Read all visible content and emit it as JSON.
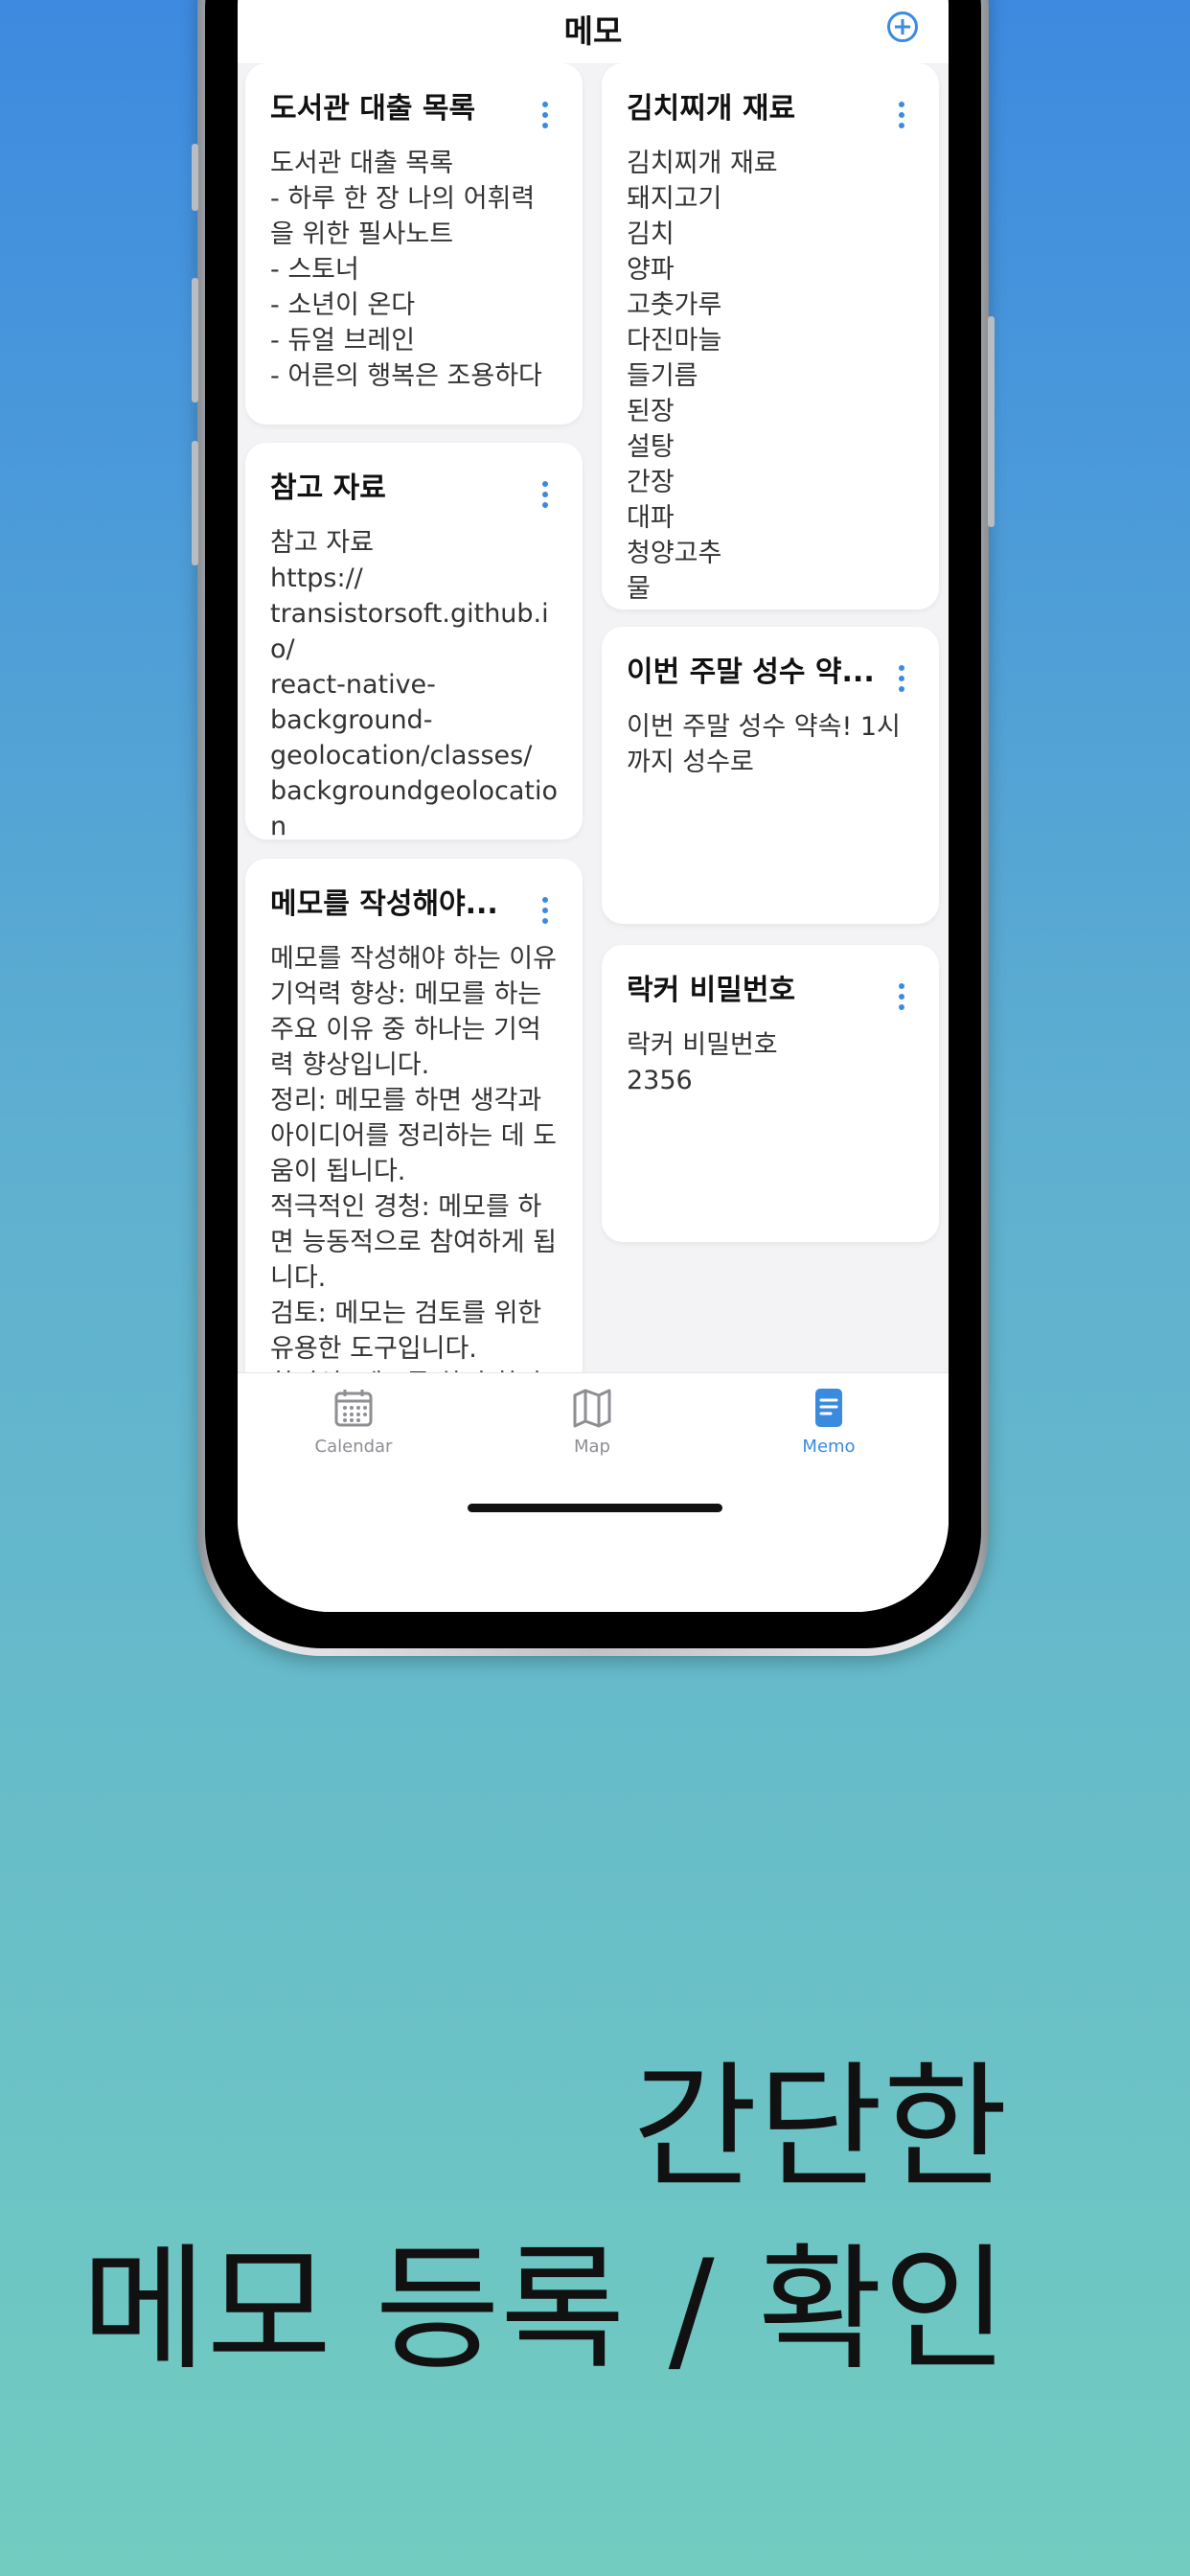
{
  "header": {
    "title": "메모"
  },
  "memos_left": [
    {
      "title": "도서관 대출 목록",
      "body": "도서관 대출 목록\n- 하루 한 장 나의 어휘력을 위한 필사노트\n- 스토너\n- 소년이 온다\n- 듀얼 브레인\n- 어른의 행복은 조용하다"
    },
    {
      "title": "참고 자료",
      "body": "참고 자료\nhttps://\ntransistorsoft.github.io/\nreact-native-\nbackground-\ngeolocation/classes/\nbackgroundgeolocation\n.html#getgeofence"
    },
    {
      "title": "메모를 작성해야...",
      "body": "메모를 작성해야 하는 이유\n기억력 향상: 메모를 하는 주요 이유 중 하나는 기억력 향상입니다.\n정리: 메모를 하면 생각과 아이디어를 정리하는 데 도움이 됩니다.\n적극적인 경청: 메모를 하면 능동적으로 참여하게 됩니다.\n검토: 메모는 검토를 위한 유용한 도구입니다.\n창의성: 메모를 하면 창의성도 자극할 수 있습니다. 아이"
    }
  ],
  "memos_right": [
    {
      "title": "김치찌개 재료",
      "body": "김치찌개 재료\n돼지고기\n김치\n양파\n고춧가루\n다진마늘\n들기름\n된장\n설탕\n간장\n대파\n청양고추\n물\n새우젓"
    },
    {
      "title": "이번 주말 성수 약...",
      "body": "이번 주말 성수 약속! 1시까지 성수로"
    },
    {
      "title": "락커 비밀번호",
      "body": "락커 비밀번호\n2356"
    }
  ],
  "tabs": [
    {
      "label": "Calendar",
      "icon": "calendar-icon",
      "active": false
    },
    {
      "label": "Map",
      "icon": "map-icon",
      "active": false
    },
    {
      "label": "Memo",
      "icon": "memo-icon",
      "active": true
    }
  ],
  "caption": {
    "line1": "간단한",
    "line2": "메모 등록 / 확인"
  },
  "colors": {
    "accent": "#3a8be0",
    "bg_top": "#3d8ae0",
    "bg_bottom": "#72ccc0"
  }
}
